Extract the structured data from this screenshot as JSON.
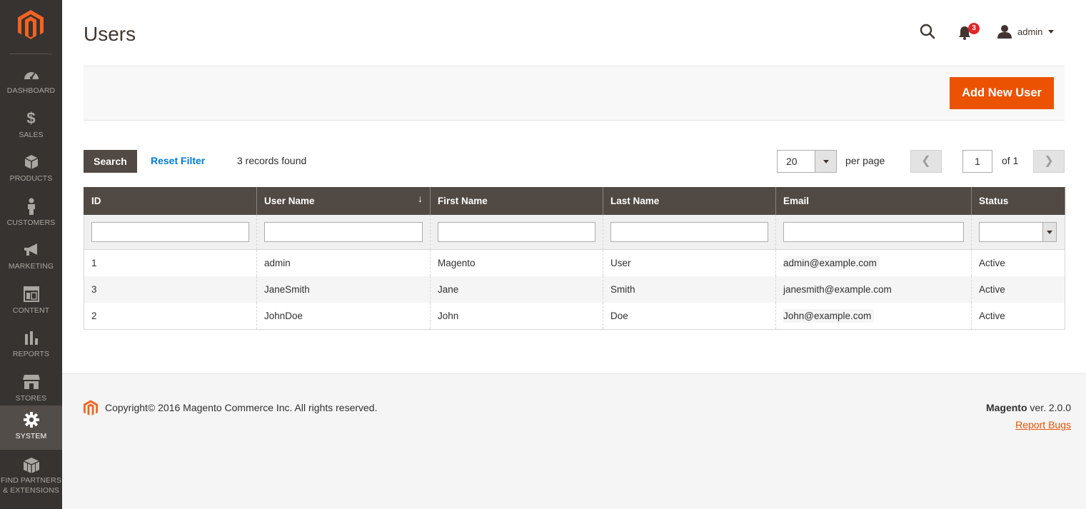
{
  "app": {
    "title": "Users"
  },
  "sidebar": {
    "items": [
      {
        "label": "DASHBOARD",
        "icon": "dashboard-icon"
      },
      {
        "label": "SALES",
        "icon": "dollar-icon"
      },
      {
        "label": "PRODUCTS",
        "icon": "box-icon"
      },
      {
        "label": "CUSTOMERS",
        "icon": "person-icon"
      },
      {
        "label": "MARKETING",
        "icon": "megaphone-icon"
      },
      {
        "label": "CONTENT",
        "icon": "layout-icon"
      },
      {
        "label": "REPORTS",
        "icon": "bar-chart-icon"
      },
      {
        "label": "STORES",
        "icon": "storefront-icon"
      },
      {
        "label": "SYSTEM",
        "icon": "gear-icon",
        "active": true
      },
      {
        "label_line1": "FIND PARTNERS",
        "label_line2": "& EXTENSIONS",
        "icon": "blocks-icon"
      }
    ]
  },
  "header": {
    "notifications_count": "3",
    "user_name": "admin"
  },
  "actionbar": {
    "add_button": "Add New User"
  },
  "toolbar": {
    "search_button": "Search",
    "reset_filter": "Reset Filter",
    "records_found": "3 records found",
    "per_page_value": "20",
    "per_page_label": "per page",
    "current_page": "1",
    "page_of": "of 1"
  },
  "table": {
    "columns": [
      "ID",
      "User Name",
      "First Name",
      "Last Name",
      "Email",
      "Status"
    ],
    "sort_indicator": "↓",
    "rows": [
      {
        "id": "1",
        "username": "admin",
        "first": "Magento",
        "last": "User",
        "email": "admin@example.com",
        "status": "Active"
      },
      {
        "id": "3",
        "username": "JaneSmith",
        "first": "Jane",
        "last": "Smith",
        "email": "janesmith@example.com",
        "status": "Active"
      },
      {
        "id": "2",
        "username": "JohnDoe",
        "first": "John",
        "last": "Doe",
        "email": "John@example.com",
        "status": "Active"
      }
    ]
  },
  "footer": {
    "copyright": "Copyright© 2016 Magento Commerce Inc. All rights reserved.",
    "brand": "Magento",
    "version": " ver. 2.0.0",
    "report_bugs": "Report Bugs"
  },
  "colors": {
    "sidebar_bg": "#373330",
    "accent": "#eb5202",
    "header_bg": "#514943",
    "link": "#007bdb"
  }
}
